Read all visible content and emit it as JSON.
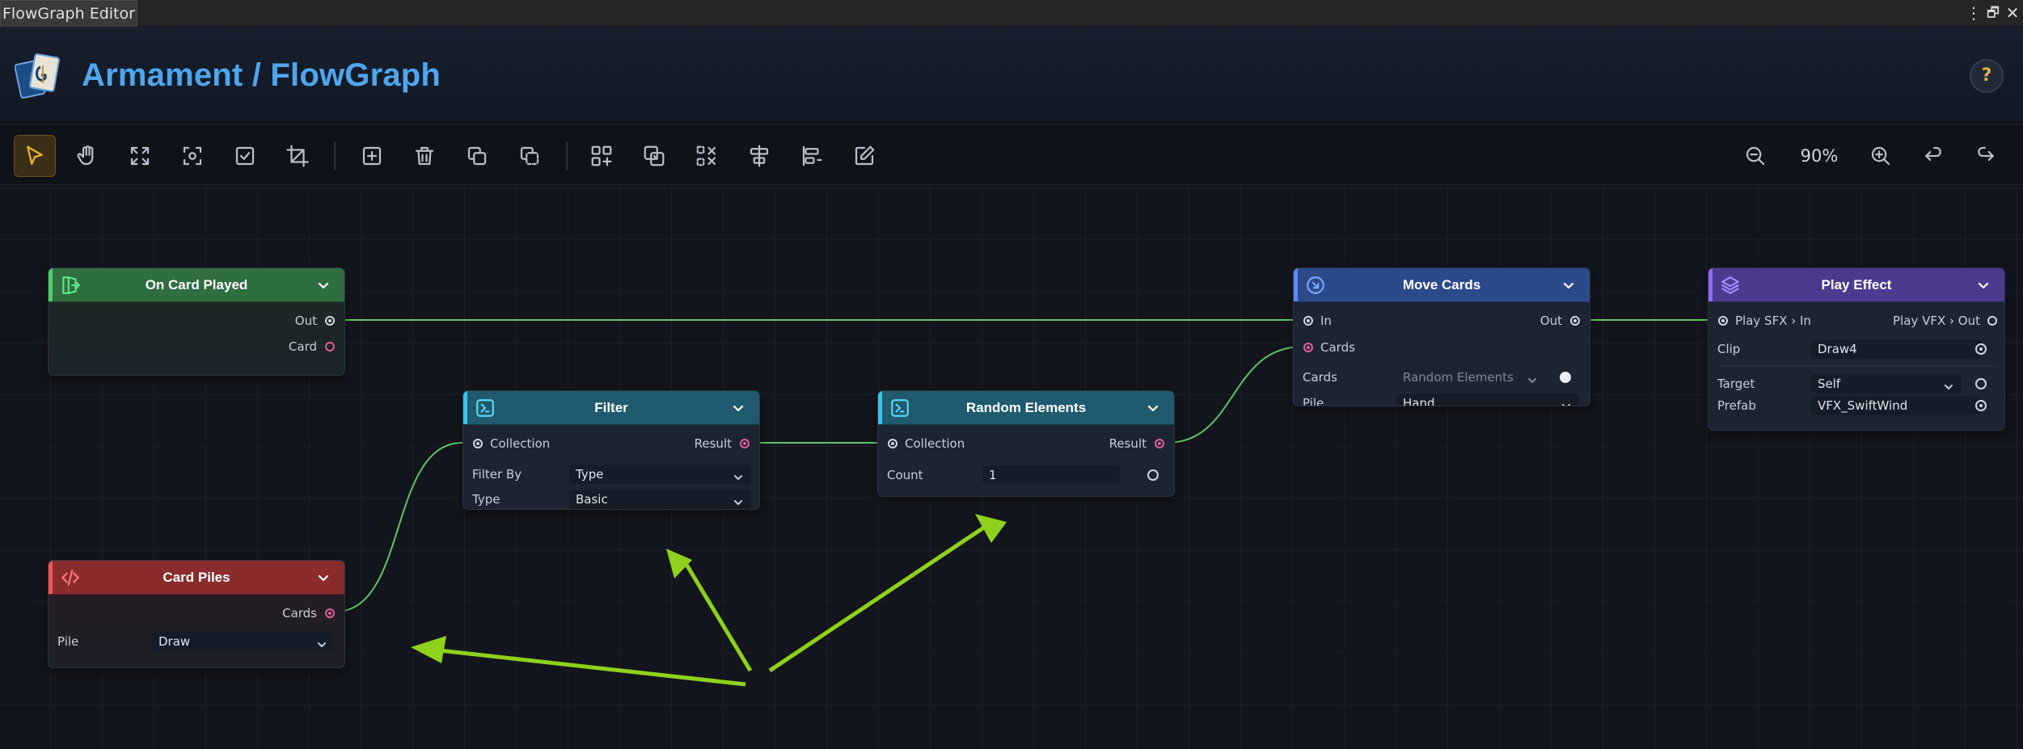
{
  "window": {
    "tab_title": "FlowGraph Editor"
  },
  "header": {
    "title": "Armament / FlowGraph",
    "help_label": "?"
  },
  "toolbar": {
    "zoom_level": "90%",
    "tools": [
      "select-tool",
      "pan-tool",
      "fit-view",
      "focus-selection",
      "select-all",
      "crop",
      "add-node",
      "delete",
      "duplicate",
      "copy",
      "group",
      "ungroup",
      "remove-group",
      "align",
      "distribute",
      "edit"
    ]
  },
  "colors": {
    "accent": "#4fa6ef",
    "wire": "#5ec46a",
    "active_tool": "#f0b429",
    "annotation_arrow": "#8fd11c"
  },
  "nodes": {
    "on_card_played": {
      "title": "On Card Played",
      "outputs": [
        "Out",
        "Card"
      ],
      "color": "#2f6e3f"
    },
    "card_piles": {
      "title": "Card Piles",
      "outputs": [
        "Cards"
      ],
      "field_label": "Pile",
      "field_value": "Draw",
      "color": "#8a2c2c"
    },
    "filter": {
      "title": "Filter",
      "input": "Collection",
      "output": "Result",
      "fields": [
        {
          "label": "Filter By",
          "value": "Type"
        },
        {
          "label": "Type",
          "value": "Basic"
        }
      ],
      "color": "#1f5a6e"
    },
    "random_elements": {
      "title": "Random Elements",
      "input": "Collection",
      "output": "Result",
      "field_label": "Count",
      "field_value": "1",
      "color": "#1f5a6e"
    },
    "move_cards": {
      "title": "Move Cards",
      "input_in": "In",
      "output_out": "Out",
      "input_cards": "Cards",
      "fields": [
        {
          "label": "Cards",
          "value": "Random Elements"
        },
        {
          "label": "Pile",
          "value": "Hand"
        }
      ],
      "color": "#2c4a8a"
    },
    "play_effect": {
      "title": "Play Effect",
      "input": "Play SFX › In",
      "output": "Play VFX › Out",
      "fields": [
        {
          "label": "Clip",
          "value": "Draw4"
        },
        {
          "label": "Target",
          "value": "Self"
        },
        {
          "label": "Prefab",
          "value": "VFX_SwiftWind"
        }
      ],
      "color": "#4b3a8e"
    }
  }
}
